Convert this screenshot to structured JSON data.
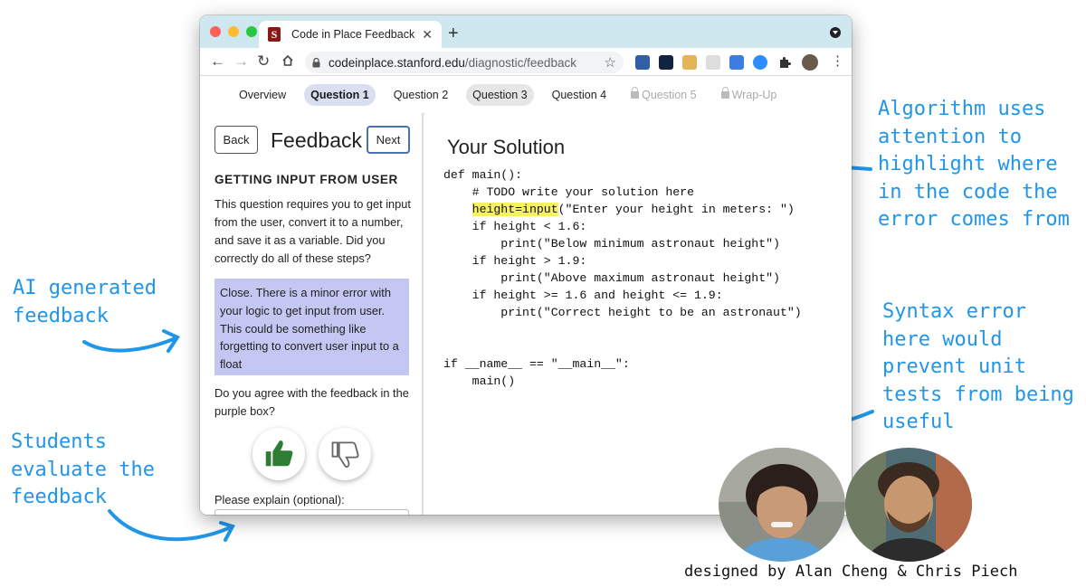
{
  "browser": {
    "tab_title": "Code in Place Feedback",
    "favicon_letter": "S",
    "new_tab": "+",
    "url_host": "codeinplace.stanford.edu",
    "url_path": "/diagnostic/feedback"
  },
  "nav": {
    "items": [
      {
        "label": "Overview"
      },
      {
        "label": "Question 1"
      },
      {
        "label": "Question 2"
      },
      {
        "label": "Question 3"
      },
      {
        "label": "Question 4"
      },
      {
        "label": "Question 5"
      },
      {
        "label": "Wrap-Up"
      }
    ]
  },
  "left": {
    "back_label": "Back",
    "title": "Feedback",
    "next_label": "Next",
    "section_title": "GETTING INPUT FROM USER",
    "question": "This question requires you to get input from the user, convert it to a number, and save it as a variable. Did you correctly do all of these steps?",
    "feedback": "Close. There is a minor error with your logic to get input from user. This could be something like forgetting to convert user input to a float",
    "agree_question": "Do you agree with the feedback in the purple box?",
    "explain_label": "Please explain (optional):"
  },
  "right": {
    "title": "Your Solution",
    "code": {
      "l1": "def main():",
      "l2": "    # TODO write your solution here",
      "l3_highlight": "height=input",
      "l3_rest": "(\"Enter your height in meters: \")",
      "l4": "    if height < 1.6:",
      "l5": "        print(\"Below minimum astronaut height\")",
      "l6": "    if height > 1.9:",
      "l7": "        print(\"Above maximum astronaut height\")",
      "l8": "    if height >= 1.6 and height <= 1.9:",
      "l9": "        print(\"Correct height to be an astronaut\")",
      "l10": "if __name__ == \"__main__\":",
      "l11": "    main()"
    }
  },
  "annotations": {
    "algorithm": "Algorithm uses\nattention to\nhighlight where\nin the code the\nerror comes from",
    "ai_feedback": "AI generated\nfeedback",
    "students": "Students\nevaluate the\nfeedback",
    "syntax": "Syntax error\nhere would\nprevent unit\ntests from being\nuseful",
    "credit": "designed by Alan Cheng & Chris Piech"
  },
  "colors": {
    "annotation_blue": "#2196e8",
    "feedback_purple": "#c5c7f3",
    "code_highlight": "#f6f25f",
    "thumbs_up_green": "#2e7d32",
    "tabstrip": "#cfe7ee"
  },
  "icons": [
    "stanford-favicon",
    "close-icon",
    "back-arrow-icon",
    "forward-arrow-icon",
    "reload-icon",
    "home-icon",
    "lock-icon",
    "star-icon",
    "puzzle-icon",
    "kebab-icon",
    "thumbs-up-icon",
    "thumbs-down-icon"
  ]
}
